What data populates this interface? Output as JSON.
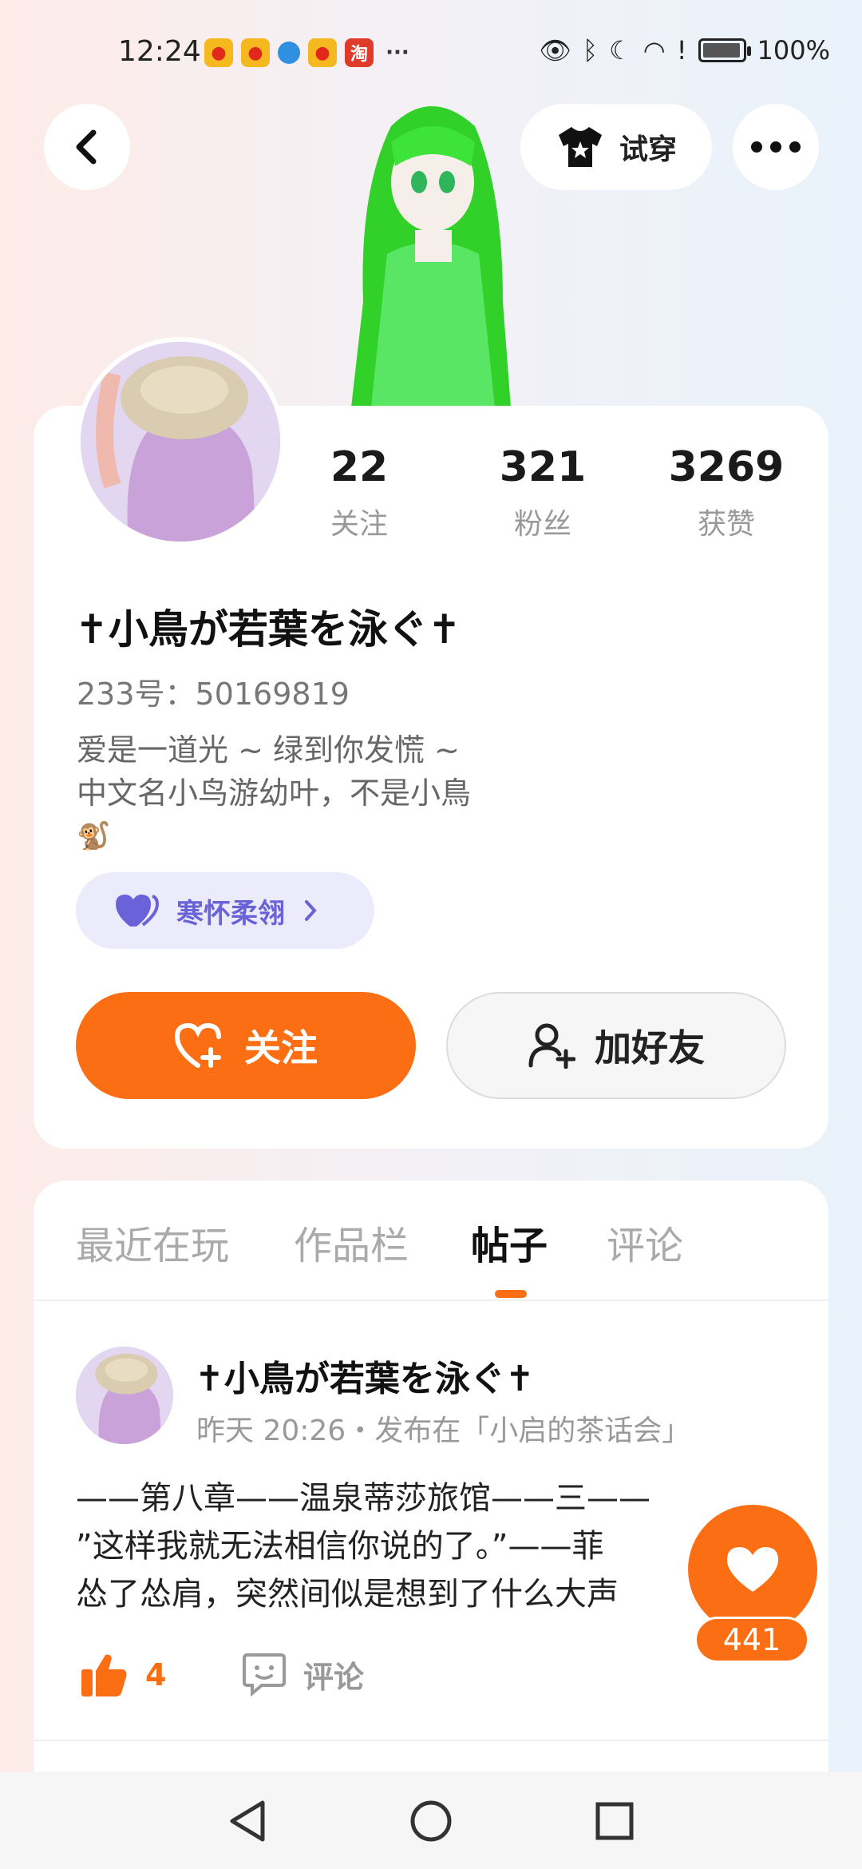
{
  "status_bar": {
    "time": "12:24",
    "notifications": [
      "weibo",
      "weibo",
      "globe",
      "weibo",
      "taobao"
    ],
    "taobao_label": "淘",
    "more": "···",
    "battery": "100%"
  },
  "header": {
    "tryon_label": "试穿"
  },
  "profile": {
    "stats": [
      {
        "value": "22",
        "label": "关注"
      },
      {
        "value": "321",
        "label": "粉丝"
      },
      {
        "value": "3269",
        "label": "获赞"
      }
    ],
    "username": "✝小鳥が若葉を泳ぐ✝",
    "user_id": "233号：50169819",
    "bio_line1": "爱是一道光 ~ 绿到你发慌 ~",
    "bio_line2": "中文名小鸟游幼叶，不是小鳥",
    "bio_emoji": "🐒",
    "badge_label": "寒怀柔翎",
    "follow_label": "关注",
    "add_friend_label": "加好友"
  },
  "tabs": [
    {
      "label": "最近在玩",
      "active": false
    },
    {
      "label": "作品栏",
      "active": false
    },
    {
      "label": "帖子",
      "active": true
    },
    {
      "label": "评论",
      "active": false
    }
  ],
  "post": {
    "author": "✝小鳥が若葉を泳ぐ✝",
    "meta": "昨天 20:26・发布在「小启的茶话会」",
    "line1": "——第八章——温泉蒂莎旅馆——三——",
    "line2": "”这样我就无法相信你说的了。”——菲",
    "line3": "怂了怂肩，突然间似是想到了什么大声",
    "likes": "4",
    "comment_label": "评论"
  },
  "float": {
    "count": "441"
  },
  "colors": {
    "accent": "#fb6e14",
    "badge": "#6a62d8"
  }
}
